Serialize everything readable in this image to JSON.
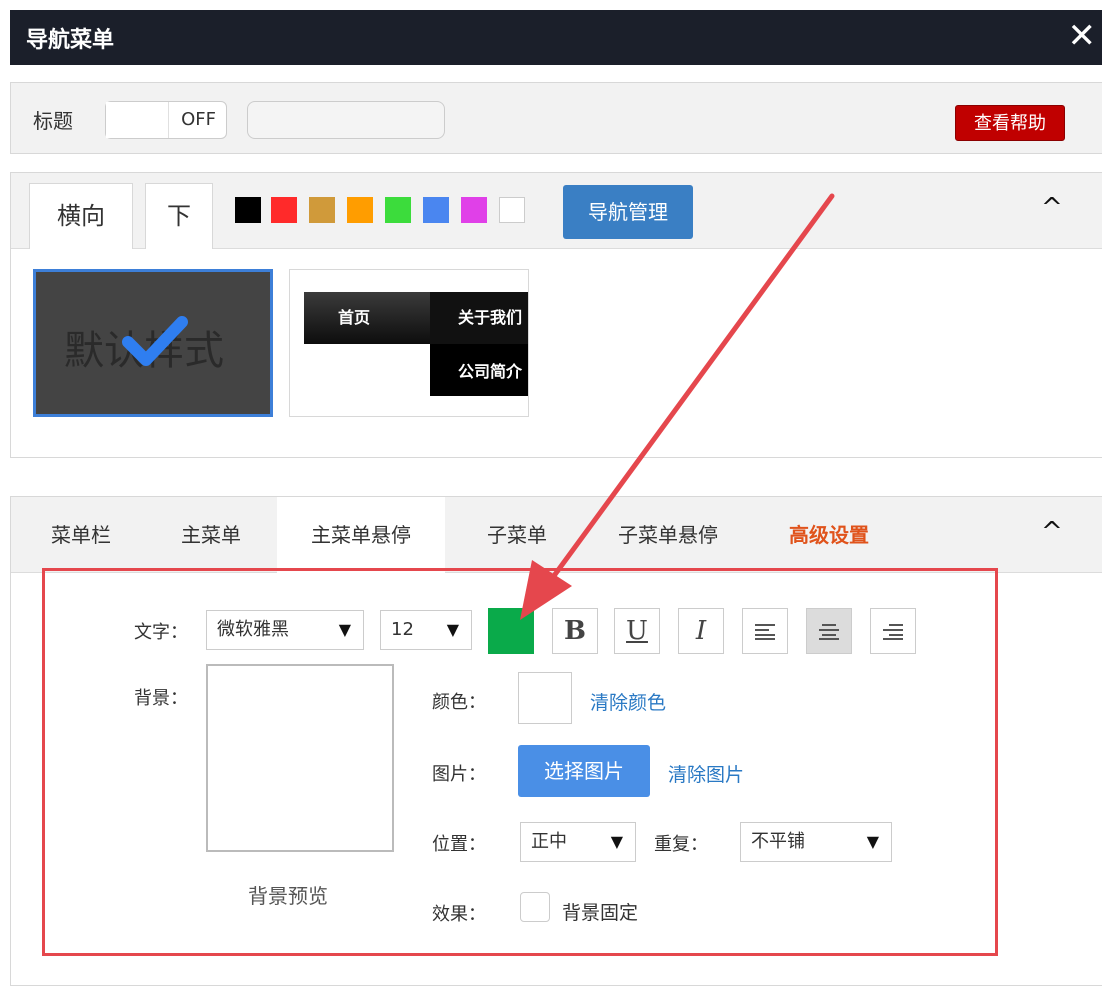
{
  "window": {
    "title": "导航菜单",
    "close_glyph": "✕"
  },
  "title_row": {
    "label": "标题",
    "toggle_state": "OFF",
    "input_value": "",
    "help_label": "查看帮助"
  },
  "style_panel": {
    "tabs": [
      "横向",
      "下"
    ],
    "swatches": [
      "#000000",
      "#ff2a2a",
      "#d09a3a",
      "#ff9d00",
      "#3cdc3c",
      "#4a86f0",
      "#e040e8",
      "#ffffff"
    ],
    "nav_manage_label": "导航管理",
    "collapse_glyph": "^",
    "default_style_label": "默认样式",
    "preview_items": {
      "home": "首页",
      "about": "关于我们",
      "profile": "公司简介"
    }
  },
  "settings_panel": {
    "tabs": [
      "菜单栏",
      "主菜单",
      "主菜单悬停",
      "子菜单",
      "子菜单悬停",
      "高级设置"
    ],
    "active_tab": "主菜单悬停",
    "collapse_glyph": "^",
    "text_label": "文字：",
    "font_family": "微软雅黑",
    "font_size": "12",
    "text_color": "#0aaa4a",
    "format_buttons": [
      "B",
      "U",
      "I"
    ],
    "bg_label": "背景：",
    "bg_preview_label": "背景预览",
    "color_label": "颜色：",
    "clear_color": "清除颜色",
    "image_label": "图片：",
    "select_image": "选择图片",
    "clear_image": "清除图片",
    "position_label": "位置：",
    "position_value": "正中",
    "repeat_label": "重复：",
    "repeat_value": "不平铺",
    "effect_label": "效果：",
    "fixed_bg_label": "背景固定"
  },
  "annotation": {
    "highlight_color": "#e5474d"
  }
}
